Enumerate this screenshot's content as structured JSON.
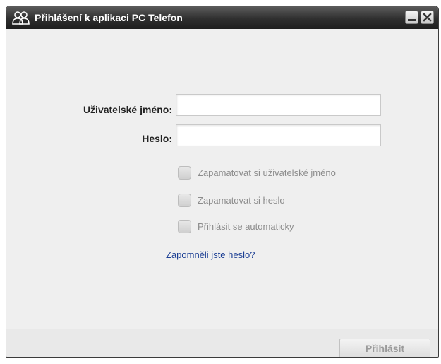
{
  "window": {
    "title": "Přihlášení k aplikaci PC Telefon",
    "app_icon": "users-icon",
    "minimize_icon": "minimize-icon",
    "close_icon": "close-icon"
  },
  "form": {
    "username_label": "Uživatelské jméno:",
    "username_value": "",
    "password_label": "Heslo:",
    "password_value": ""
  },
  "options": [
    {
      "label": "Zapamatovat si uživatelské jméno",
      "checked": false,
      "enabled": false
    },
    {
      "label": "Zapamatovat si heslo",
      "checked": false,
      "enabled": false
    },
    {
      "label": "Přihlásit se automaticky",
      "checked": false,
      "enabled": false
    }
  ],
  "forgot_link": "Zapomněli jste heslo?",
  "footer": {
    "login_button": "Přihlásit",
    "login_enabled": false
  },
  "colors": {
    "link": "#1c3f94",
    "titlebar": "#2f2f2f",
    "disabled_text": "#8c8c8c"
  }
}
